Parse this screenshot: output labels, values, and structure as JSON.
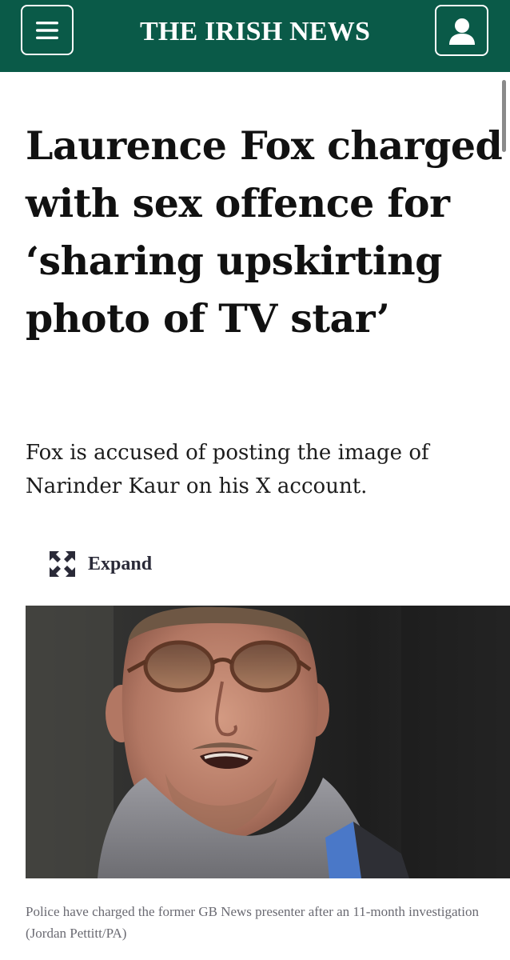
{
  "header": {
    "masthead": "THE IRISH NEWS",
    "menu_icon": "hamburger-menu-icon",
    "account_icon": "user-account-icon",
    "brand_color": "#0a5a48"
  },
  "article": {
    "headline": "Laurence Fox charged with sex offence for ‘sharing upskirting photo of TV star’",
    "standfirst": "Fox is accused of posting the image of Narinder Kaur on his X account.",
    "expand_label": "Expand",
    "expand_icon": "expand-arrows-icon",
    "image_caption": "Police have charged the former GB News presenter after an 11-month investigation (Jordan Pettitt/PA)"
  }
}
